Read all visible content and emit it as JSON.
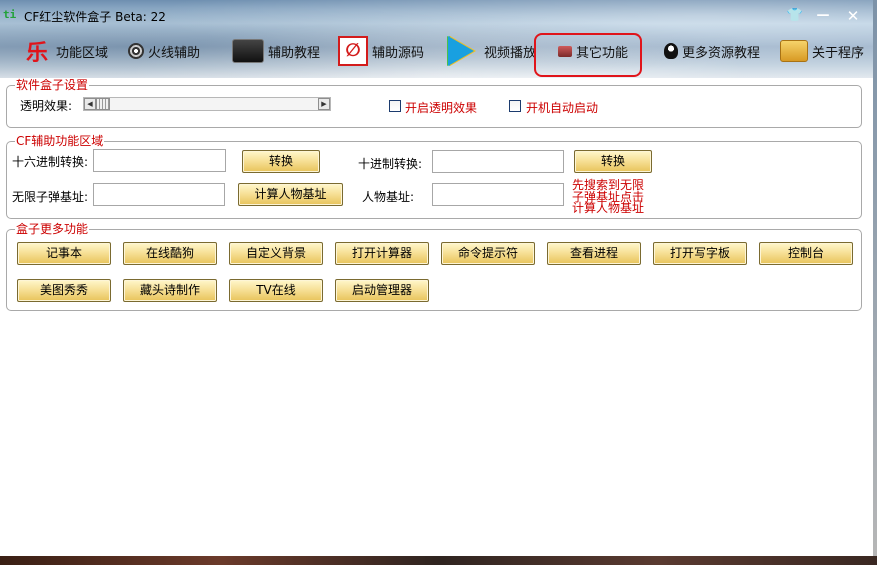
{
  "window": {
    "app_icon": "ti",
    "title": "CF红尘软件盒子 Beta: 22",
    "skin_icon": "tshirt-icon",
    "minimize_icon": "minimize-icon",
    "close_icon": "close-icon"
  },
  "toolbar": {
    "items": [
      {
        "label": "功能区域",
        "icon": "乐"
      },
      {
        "label": "火线辅助",
        "icon": "crosshair-icon"
      },
      {
        "label": "辅助教程",
        "icon": "film-camera-icon"
      },
      {
        "label": "辅助源码",
        "icon": "source-icon"
      },
      {
        "label": "视频播放",
        "icon": "play-icon"
      },
      {
        "label": "其它功能",
        "icon": "tools-icon"
      },
      {
        "label": "更多资源教程",
        "icon": "qq-icon"
      },
      {
        "label": "关于程序",
        "icon": "folder-icon"
      }
    ],
    "highlight_color": "#e0141a"
  },
  "settings_group": {
    "title": "软件盒子设置",
    "transparency_label": "透明效果:",
    "enable_transparency_label": "开启透明效果",
    "autostart_label": "开机自动启动"
  },
  "cf_group": {
    "title": "CF辅助功能区域",
    "hex_label": "十六进制转换:",
    "hex_value": "",
    "convert1_label": "转换",
    "dec_label": "十进制转换:",
    "dec_value": "",
    "convert2_label": "转换",
    "ammo_label": "无限子弹基址:",
    "ammo_value": "",
    "calc_button_label": "计算人物基址",
    "char_label": "人物基址:",
    "char_value": "",
    "hint_lines": [
      "先搜索到无限",
      "子弹基址点击",
      "计算人物基址"
    ]
  },
  "more_group": {
    "title": "盒子更多功能",
    "buttons_row1": [
      "记事本",
      "在线酷狗",
      "自定义背景",
      "打开计算器",
      "命令提示符",
      "查看进程",
      "打开写字板",
      "控制台"
    ],
    "buttons_row2": [
      "美图秀秀",
      "藏头诗制作",
      "TV在线",
      "启动管理器"
    ]
  },
  "colors": {
    "accent_red": "#cc0000",
    "button_gold": "#f7e199"
  }
}
